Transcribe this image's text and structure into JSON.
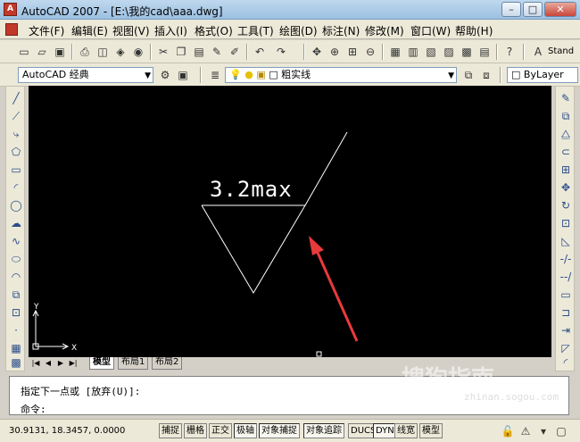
{
  "window": {
    "title": "AutoCAD 2007 - [E:\\我的cad\\aaa.dwg]",
    "minimize": "–",
    "restore": "□",
    "close": "✕"
  },
  "menu": {
    "items": [
      "文件(F)",
      "编辑(E)",
      "视图(V)",
      "插入(I)",
      "格式(O)",
      "工具(T)",
      "绘图(D)",
      "标注(N)",
      "修改(M)",
      "窗口(W)",
      "帮助(H)"
    ]
  },
  "toolbar": {
    "style_label": "Stand",
    "workspace": "AutoCAD 经典",
    "layer_name": "粗实线",
    "linetype": "ByLayer"
  },
  "drawing": {
    "annotation": "3.2max",
    "ucs_x": "X",
    "ucs_y": "Y",
    "arrow_color": "#e83a3a"
  },
  "tabs": {
    "items": [
      "模型",
      "布局1",
      "布局2"
    ]
  },
  "command": {
    "line1": "指定下一点或 [放弃(U)]:",
    "line2": "命令:"
  },
  "status": {
    "coords": "30.9131, 18.3457, 0.0000",
    "toggles": [
      "捕捉",
      "栅格",
      "正交",
      "极轴",
      "对象捕捉",
      "对象追踪",
      "DUCS",
      "DYN",
      "线宽",
      "模型"
    ]
  },
  "watermark": {
    "text": "搜狗指南",
    "url": "zhinan.sogou.com"
  }
}
